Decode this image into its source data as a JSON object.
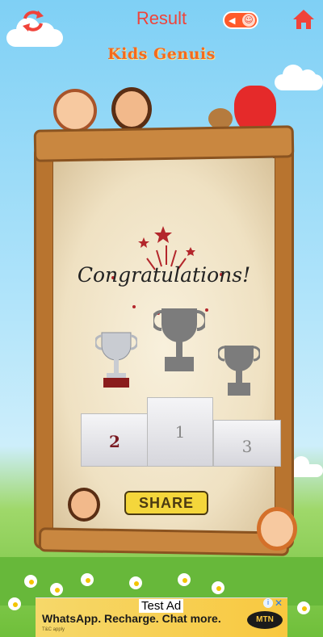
{
  "header": {
    "title": "Result",
    "refresh_icon": "refresh-icon",
    "home_icon": "home-icon",
    "sound_icon": "speaker-icon"
  },
  "brand": "Kids Genuis",
  "board": {
    "message": "Congratulations!",
    "podium": {
      "first": "1",
      "second": "2",
      "third": "3"
    },
    "share_label": "SHARE"
  },
  "ad": {
    "label": "Test Ad",
    "text": "WhatsApp. Recharge. Chat more.",
    "brand": "MTN",
    "fine_print": "T&C apply"
  },
  "colors": {
    "title": "#f0433a",
    "accent": "#ff5a2a",
    "share_bg": "#f4d63b"
  }
}
